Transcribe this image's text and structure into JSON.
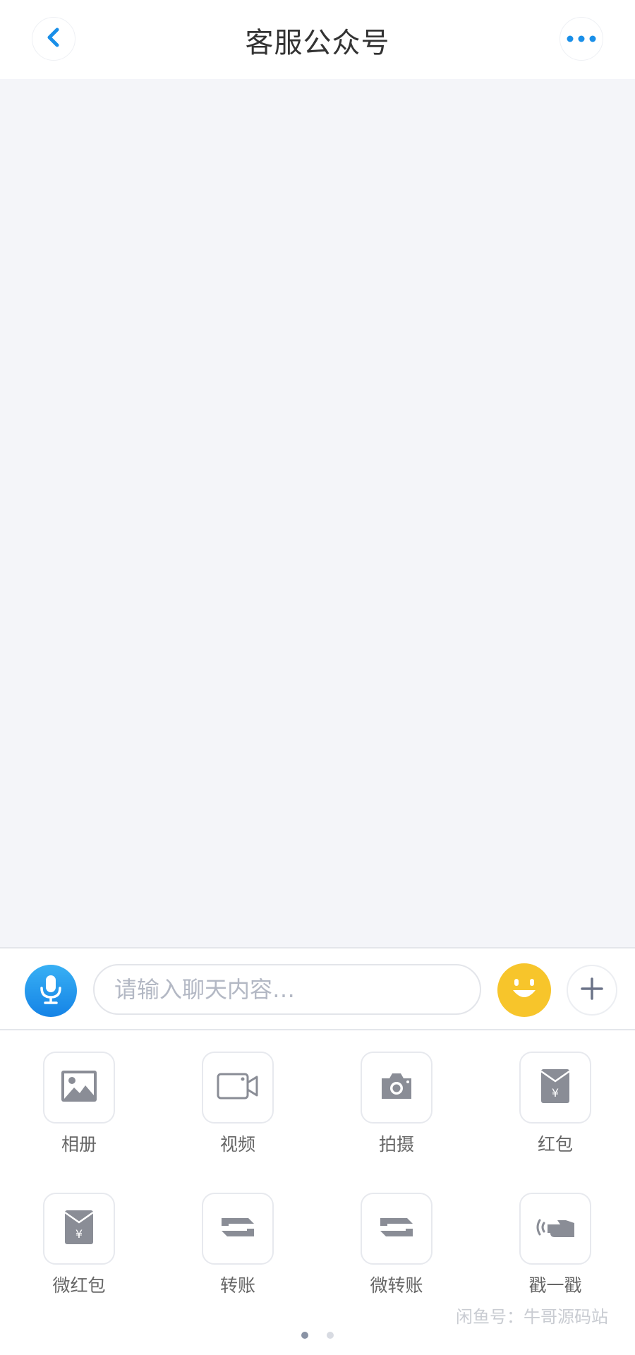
{
  "header": {
    "title": "客服公众号",
    "back_icon": "chevron-left-icon",
    "more_icon": "more-dots-icon"
  },
  "input_bar": {
    "placeholder": "请输入聊天内容…",
    "voice_icon": "microphone-icon",
    "emoji_icon": "smiley-emoji-icon",
    "plus_icon": "plus-icon"
  },
  "tools": [
    {
      "label": "相册",
      "icon": "photo-album-icon"
    },
    {
      "label": "视频",
      "icon": "video-camera-icon"
    },
    {
      "label": "拍摄",
      "icon": "camera-icon"
    },
    {
      "label": "红包",
      "icon": "red-envelope-icon"
    },
    {
      "label": "微红包",
      "icon": "red-envelope-icon"
    },
    {
      "label": "转账",
      "icon": "transfer-icon"
    },
    {
      "label": "微转账",
      "icon": "transfer-icon"
    },
    {
      "label": "戳一戳",
      "icon": "poke-hand-icon"
    }
  ],
  "pager": {
    "pages": 2,
    "active": 1
  },
  "watermark": "闲鱼号：牛哥源码站",
  "colors": {
    "accent_blue": "#1a8fe8",
    "emoji_yellow": "#f7c52b",
    "chat_background": "#f4f5f9",
    "icon_gray": "#8a8d96"
  }
}
